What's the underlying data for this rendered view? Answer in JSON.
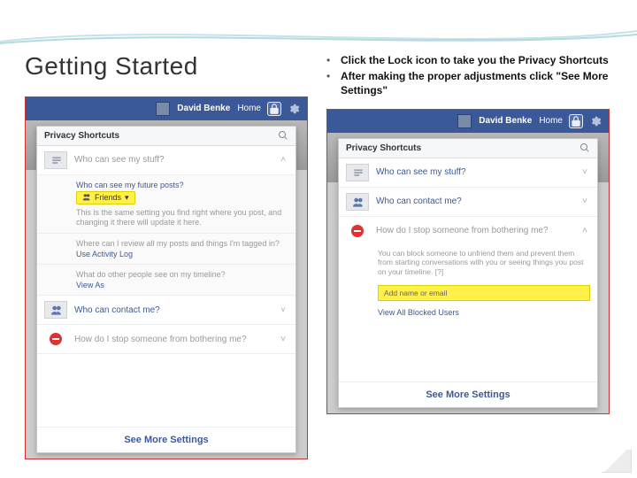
{
  "slide": {
    "title": "Getting Started",
    "bullets": [
      "Click the Lock icon to take you the Privacy Shortcuts",
      "After making the proper adjustments click \"See More Settings\""
    ]
  },
  "topbar": {
    "user": "David Benke",
    "home": "Home"
  },
  "panelA": {
    "header": "Privacy Shortcuts",
    "q_see_stuff": "Who can see my stuff?",
    "q_future_posts": "Who can see my future posts?",
    "friends_badge": "Friends",
    "future_desc": "This is the same setting you find right where you post, and changing it there will update it here.",
    "q_review": "Where can I review all my posts and things I'm tagged in?",
    "review_link": "Use Activity Log",
    "q_others": "What do other people see on my timeline?",
    "viewas_link": "View As",
    "q_contact": "Who can contact me?",
    "q_stop": "How do I stop someone from bothering me?",
    "footer": "See More Settings"
  },
  "panelB": {
    "header": "Privacy Shortcuts",
    "q_see_stuff": "Who can see my stuff?",
    "q_contact": "Who can contact me?",
    "q_stop": "How do I stop someone from bothering me?",
    "block_desc": "You can block someone to unfriend them and prevent them from starting conversations with you or seeing things you post on your timeline. [?]",
    "input_placeholder": "Add name or email",
    "view_blocked": "View All Blocked Users",
    "footer": "See More Settings"
  }
}
